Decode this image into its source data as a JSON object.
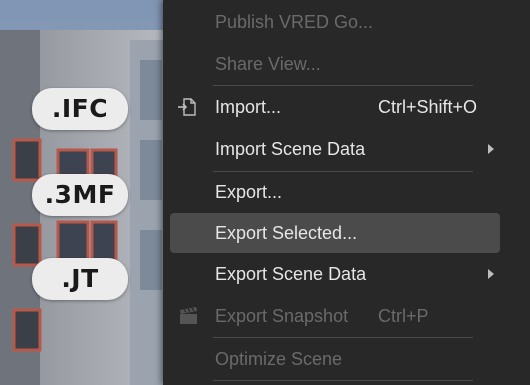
{
  "badges": [
    {
      "label": ".IFC"
    },
    {
      "label": ".3MF"
    },
    {
      "label": ".JT"
    }
  ],
  "menu": {
    "items": [
      {
        "label": "Publish VRED Go...",
        "disabled": true
      },
      {
        "label": "Share View...",
        "disabled": true
      },
      {
        "label": "Import...",
        "shortcut": "Ctrl+Shift+O",
        "icon": "import-file-icon"
      },
      {
        "label": "Import Scene Data",
        "submenu": true
      },
      {
        "label": "Export..."
      },
      {
        "label": "Export Selected...",
        "highlighted": true
      },
      {
        "label": "Export Scene Data",
        "submenu": true
      },
      {
        "label": "Export Snapshot",
        "shortcut": "Ctrl+P",
        "disabled": true,
        "icon": "clapperboard-icon"
      },
      {
        "label": "Optimize Scene",
        "disabled": true
      }
    ]
  },
  "colors": {
    "menu_bg": "#282828",
    "highlight_bg": "#4b4b4b",
    "text": "#e6e6e6",
    "disabled_text": "#6a6a6a",
    "badge_bg": "#ececec"
  }
}
